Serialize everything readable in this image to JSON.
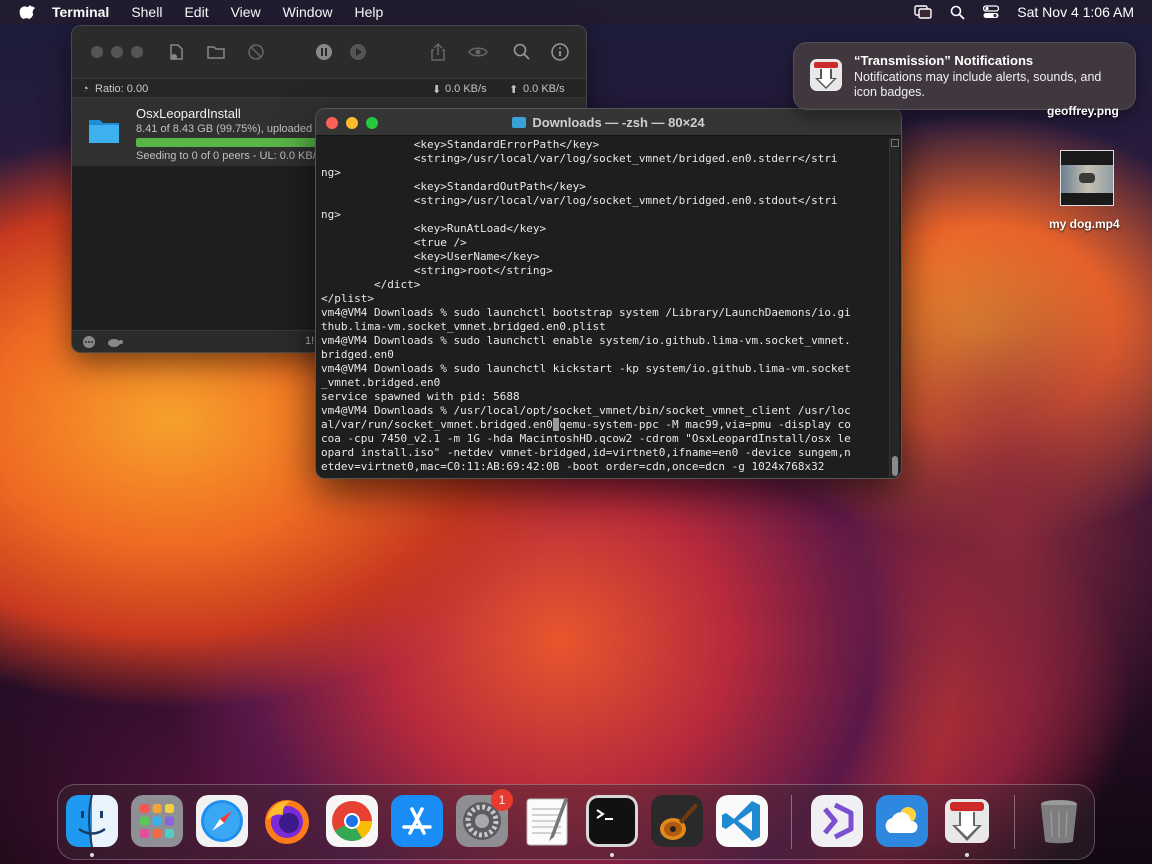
{
  "menubar": {
    "app_name": "Terminal",
    "items": [
      "Shell",
      "Edit",
      "View",
      "Window",
      "Help"
    ],
    "datetime": "Sat Nov 4  1:06 AM",
    "icons": [
      "apple-icon",
      "screen-mirroring-icon",
      "search-icon",
      "control-center-icon"
    ]
  },
  "transmission": {
    "ratio": "Ratio: 0.00",
    "download_speed": "0.0 KB/s",
    "upload_speed": "0.0 KB/s",
    "torrent": {
      "name": "OsxLeopardInstall",
      "info": "8.41 of 8.43 GB (99.75%), uploaded Z",
      "progress": 0.9975,
      "status": "Seeding to 0 of 0 peers - UL: 0.0 KB/",
      "bar_color": "#5ab548"
    },
    "bottom_count": "1!"
  },
  "terminal": {
    "title": "Downloads — -zsh — 80×24",
    "lines": [
      "              <key>StandardErrorPath</key>",
      "              <string>/usr/local/var/log/socket_vmnet/bridged.en0.stderr</stri",
      "ng>",
      "              <key>StandardOutPath</key>",
      "              <string>/usr/local/var/log/socket_vmnet/bridged.en0.stdout</stri",
      "ng>",
      "              <key>RunAtLoad</key>",
      "              <true />",
      "              <key>UserName</key>",
      "              <string>root</string>",
      "        </dict>",
      "</plist>",
      "vm4@VM4 Downloads % sudo launchctl bootstrap system /Library/LaunchDaemons/io.gi",
      "thub.lima-vm.socket_vmnet.bridged.en0.plist",
      "vm4@VM4 Downloads % sudo launchctl enable system/io.github.lima-vm.socket_vmnet.",
      "bridged.en0",
      "vm4@VM4 Downloads % sudo launchctl kickstart -kp system/io.github.lima-vm.socket",
      "_vmnet.bridged.en0",
      "service spawned with pid: 5688",
      "vm4@VM4 Downloads % /usr/local/opt/socket_vmnet/bin/socket_vmnet_client /usr/loc",
      "al/var/run/socket_vmnet.bridged.en0 qemu-system-ppc -M mac99,via=pmu -display co",
      "coa -cpu 7450_v2.1 -m 1G -hda MacintoshHD.qcow2 -cdrom \"OsxLeopardInstall/osx le",
      "opard install.iso\" -netdev vmnet-bridged,id=virtnet0,ifname=en0 -device sungem,n",
      "etdev=virtnet0,mac=C0:11:AB:69:42:0B -boot order=cdn,once=dcn -g 1024x768x32"
    ]
  },
  "notification": {
    "title": "“Transmission” Notifications",
    "body": "Notifications may include alerts, sounds, and icon badges."
  },
  "desktop": {
    "items": [
      {
        "label": "geoffrey.png"
      },
      {
        "label": "my dog.mp4"
      }
    ]
  },
  "dock": {
    "apps": [
      "Finder",
      "Launchpad",
      "Safari",
      "Firefox",
      "Chrome",
      "App Store",
      "System Settings",
      "TextEdit",
      "Terminal",
      "GarageBand",
      "Visual Studio Code",
      "Visual Studio",
      "Weather",
      "Transmission",
      "Trash"
    ],
    "settings_badge": "1"
  }
}
